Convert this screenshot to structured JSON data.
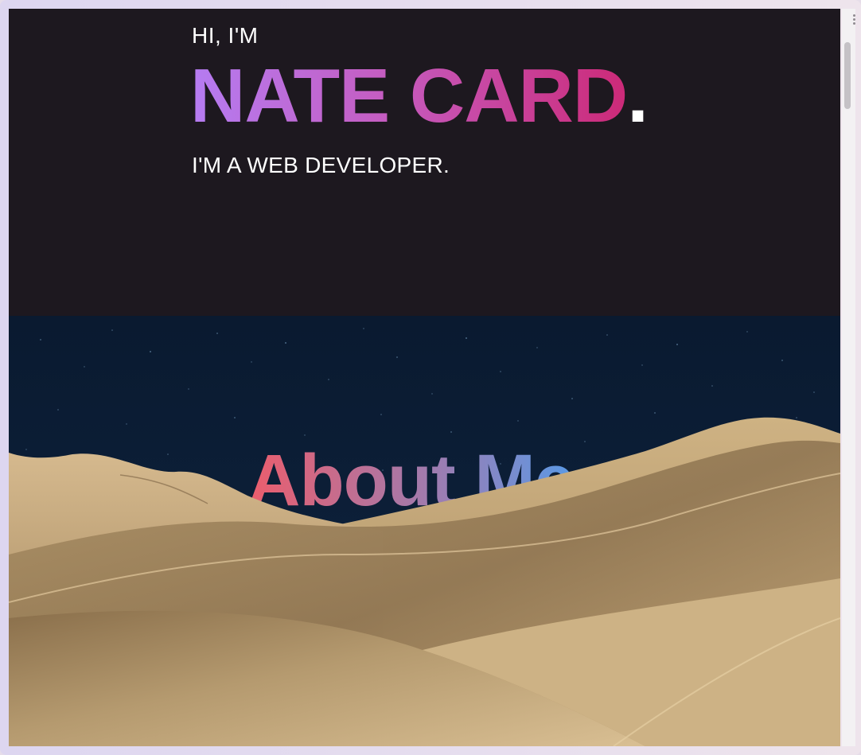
{
  "hero": {
    "greeting": "HI, I'M",
    "name": "NATE CARD",
    "name_punctuation": ".",
    "role": "I'M A WEB DEVELOPER."
  },
  "about": {
    "heading": "About Me"
  },
  "colors": {
    "hero_background": "#1d181f",
    "name_gradient_start": "#b57cf2",
    "name_gradient_end": "#cc2a78",
    "about_heading_gradient_start": "#ea5f6e",
    "about_heading_gradient_end": "#4b9ff0",
    "sky": "#0c1d33",
    "sand": "#b59a6f"
  },
  "icons": {
    "scrollbar": "scrollbar-thumb",
    "grip": "resize-grip-icon"
  }
}
